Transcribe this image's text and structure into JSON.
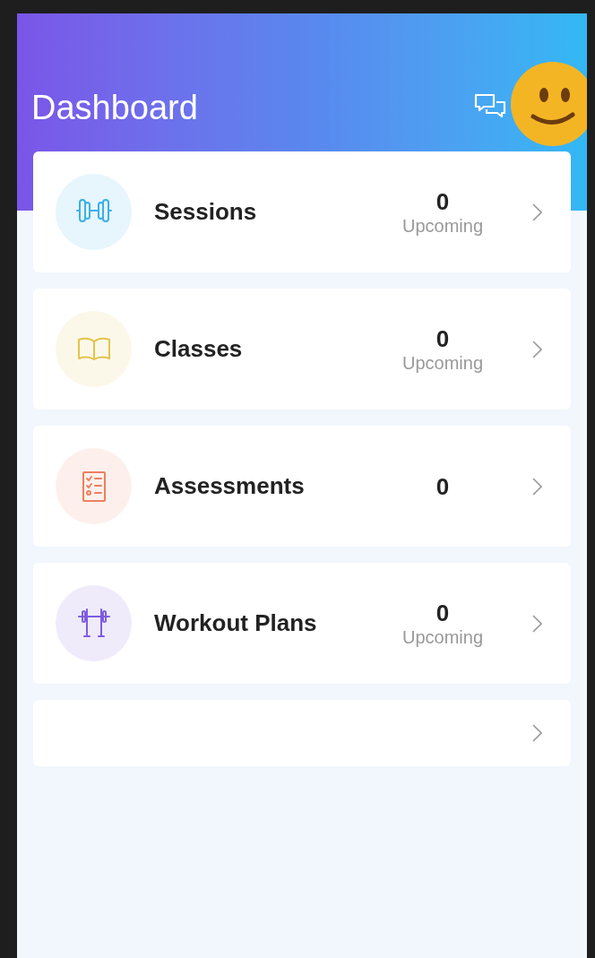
{
  "header": {
    "title": "Dashboard"
  },
  "cards": [
    {
      "kind": "dumbbell",
      "color": "#3ab0e8",
      "title": "Sessions",
      "count": "0",
      "caption": "Upcoming"
    },
    {
      "kind": "book",
      "color": "#e3c34a",
      "title": "Classes",
      "count": "0",
      "caption": "Upcoming"
    },
    {
      "kind": "checklist",
      "color": "#ec8060",
      "title": "Assessments",
      "count": "0"
    },
    {
      "kind": "barbell",
      "color": "#7d5ce0",
      "title": "Workout Plans",
      "count": "0",
      "caption": "Upcoming"
    },
    {
      "kind": "empty"
    }
  ]
}
